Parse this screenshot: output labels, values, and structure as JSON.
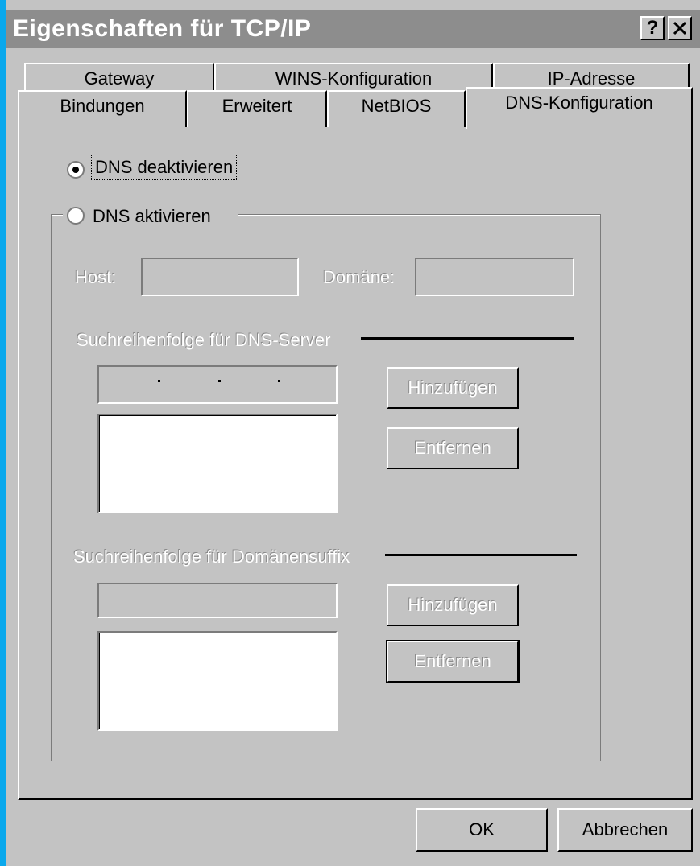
{
  "window": {
    "title": "Eigenschaften für TCP/IP",
    "help_label": "?",
    "close_label": "✕"
  },
  "tabs": {
    "back_row": [
      "Gateway",
      "WINS-Konfiguration",
      "IP-Adresse"
    ],
    "front_row": [
      "Bindungen",
      "Erweitert",
      "NetBIOS",
      "DNS-Konfiguration"
    ],
    "active": "DNS-Konfiguration"
  },
  "dns": {
    "disable_label": "DNS deaktivieren",
    "enable_label": "DNS aktivieren",
    "selected": "disable",
    "host_label": "Host:",
    "host_value": "",
    "domain_label": "Domäne:",
    "domain_value": "",
    "server_order_label": "Suchreihenfolge für DNS-Server",
    "server_ip": [
      "",
      "",
      "",
      ""
    ],
    "server_add_label": "Hinzufügen",
    "server_remove_label": "Entfernen",
    "suffix_order_label": "Suchreihenfolge für Domänensuffix",
    "suffix_value": "",
    "suffix_add_label": "Hinzufügen",
    "suffix_remove_label": "Entfernen"
  },
  "footer": {
    "ok_label": "OK",
    "cancel_label": "Abbrechen"
  },
  "colors": {
    "window_face": "#c3c3c3",
    "title_bar": "#8d8d8d",
    "desktop_strip": "#0aa8ec"
  }
}
